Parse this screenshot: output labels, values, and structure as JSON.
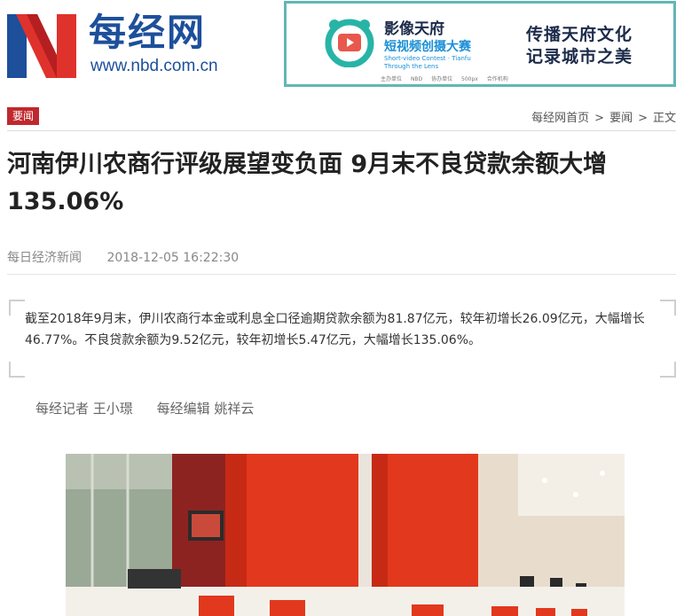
{
  "header": {
    "logo_cn": "每经网",
    "logo_url": "www.nbd.com.cn",
    "banner": {
      "title": "影像天府",
      "subtitle": "短视频创摄大赛",
      "english": "Short-video Contest · Tianfu Through the Lens",
      "slogan_line1": "传播天府文化",
      "slogan_line2": "记录城市之美",
      "sponsors": [
        "主办单位",
        "NBD",
        "协办单位",
        "500px",
        "合作机构"
      ]
    }
  },
  "breadcrumb": {
    "tag": "要闻",
    "items": [
      "每经网首页",
      "要闻",
      "正文"
    ],
    "separator": ">"
  },
  "article": {
    "title": "河南伊川农商行评级展望变负面 9月末不良贷款余额大增135.06%",
    "source": "每日经济新闻",
    "datetime": "2018-12-05 16:22:30",
    "summary": "截至2018年9月末，伊川农商行本金或利息全口径逾期贷款余额为81.87亿元，较年初增长26.09亿元，大幅增长46.77%。不良贷款余额为9.52亿元，较年初增长5.47亿元，大幅增长135.06%。",
    "reporter": "每经记者 王小璟",
    "editor": "每经编辑 姚祥云"
  },
  "colors": {
    "brand_blue": "#1d4f9b",
    "brand_red": "#c0282e",
    "banner_border": "#63b6b4"
  }
}
